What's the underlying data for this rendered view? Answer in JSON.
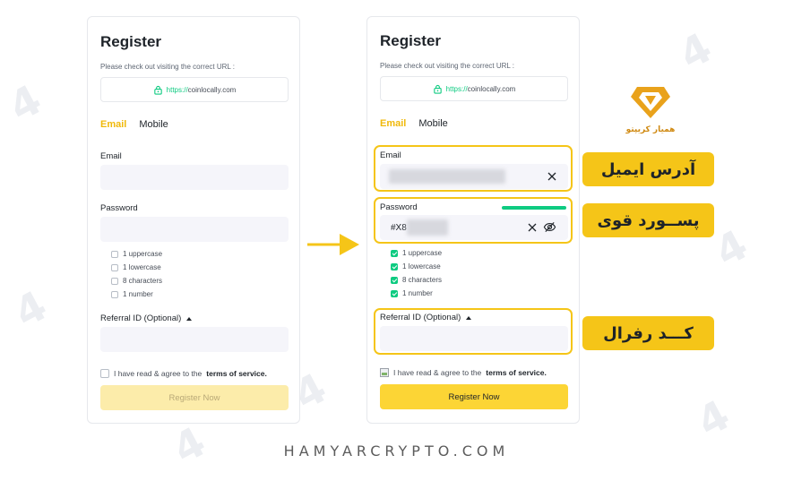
{
  "watermark_text": "4",
  "left_form": {
    "title": "Register",
    "url_hint": "Please check out visiting the correct URL :",
    "url_protocol": "https://",
    "url_host": "coinlocally.com",
    "tab_email": "Email",
    "tab_mobile": "Mobile",
    "email_label": "Email",
    "password_label": "Password",
    "requirements": [
      "1 uppercase",
      "1 lowercase",
      "8 characters",
      "1 number"
    ],
    "referral_label": "Referral ID (Optional)",
    "agree_text": "I have read & agree to the",
    "terms_text": "terms of service.",
    "submit_label": "Register Now"
  },
  "right_form": {
    "title": "Register",
    "url_hint": "Please check out visiting the correct URL :",
    "url_protocol": "https://",
    "url_host": "coinlocally.com",
    "tab_email": "Email",
    "tab_mobile": "Mobile",
    "email_label": "Email",
    "password_label": "Password",
    "password_value": "#X8",
    "requirements": [
      "1 uppercase",
      "1 lowercase",
      "8 characters",
      "1 number"
    ],
    "requirements_checked": [
      true,
      true,
      true,
      true
    ],
    "referral_label": "Referral ID (Optional)",
    "agree_text": "I have read & agree to the",
    "terms_text": "terms of service.",
    "submit_label": "Register Now"
  },
  "annotations": {
    "email": "آدرس ایمیل",
    "password": "پســورد قوی",
    "referral": "کـــد رفرال"
  },
  "logo_text": "همیار کریپتو",
  "footer": "HAMYARCRYPTO.COM",
  "colors": {
    "accent": "#f0b90b",
    "highlight": "#f5c518",
    "success": "#0ecb81",
    "button_active": "#fcd535",
    "button_disabled": "#fcecaa"
  }
}
